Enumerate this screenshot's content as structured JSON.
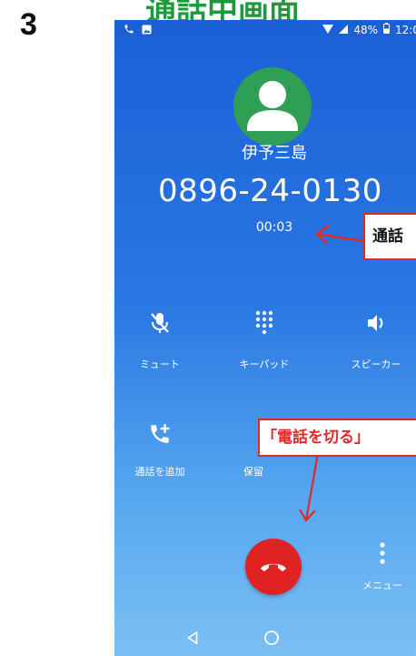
{
  "step_number": "3",
  "title": "通話中画面",
  "status_bar": {
    "battery": "48%",
    "time": "12:0"
  },
  "call": {
    "caller_name": "伊予三島",
    "phone_number": "0896-24-0130",
    "timer": "00:03"
  },
  "controls": [
    {
      "label": "ミュート",
      "icon": "mute-mic-icon"
    },
    {
      "label": "キーパッド",
      "icon": "keypad-icon"
    },
    {
      "label": "スピーカー",
      "icon": "speaker-icon"
    },
    {
      "label": "通話を追加",
      "icon": "add-call-icon"
    },
    {
      "label": "保留",
      "icon": "hold-icon"
    }
  ],
  "menu_label": "メニュー",
  "callouts": {
    "timer_note": "通話",
    "end_call_note": "「電話を切る」"
  },
  "colors": {
    "accent_red": "#e12222",
    "title_green": "#1d9a3b",
    "avatar_green": "#2e9f55"
  }
}
